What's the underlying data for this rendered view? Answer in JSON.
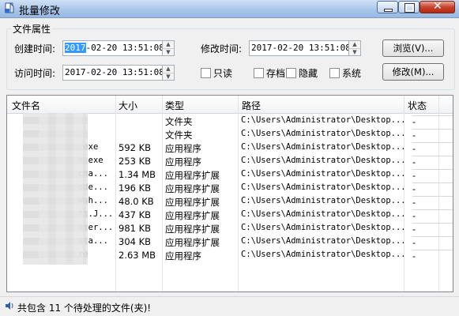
{
  "window": {
    "title": "批量修改"
  },
  "props": {
    "group_label": "文件属性",
    "created_label": "创建时间:",
    "created_sel": "2017",
    "created_rest": "-02-20 13:51:08",
    "modified_label": "修改时间:",
    "modified_value": "2017-02-20 13:51:08",
    "accessed_label": "访问时间:",
    "accessed_value": "2017-02-20 13:51:08",
    "browse_label": "浏览(V)...",
    "modify_label": "修改(M)...",
    "checks": [
      "只读",
      "存档",
      "隐藏",
      "系统"
    ]
  },
  "list": {
    "columns": [
      "文件名",
      "大小",
      "类型",
      "路径",
      "状态"
    ],
    "rows": [
      {
        "name": "",
        "size": "",
        "type": "文件夹",
        "path": "C:\\Users\\Administrator\\Desktop...",
        "status": "-"
      },
      {
        "name": "",
        "size": "",
        "type": "文件夹",
        "path": "C:\\Users\\Administrator\\Desktop...",
        "status": "-"
      },
      {
        "name": ".exe",
        "size": "592 KB",
        "type": "应用程序",
        "path": "C:\\Users\\Administrator\\Desktop...",
        "status": "-"
      },
      {
        "name": "e.exe",
        "size": "253 KB",
        "type": "应用程序",
        "path": "C:\\Users\\Administrator\\Desktop...",
        "status": "-"
      },
      {
        "name": "cha...",
        "size": "1.34 MB",
        "type": "应用程序扩展",
        "path": "C:\\Users\\Administrator\\Desktop...",
        "status": "-"
      },
      {
        "name": "ode...",
        "size": "196 KB",
        "type": "应用程序扩展",
        "path": "C:\\Users\\Administrator\\Desktop...",
        "status": "-"
      },
      {
        "name": "Wsh...",
        "size": "48.0 KB",
        "type": "应用程序扩展",
        "path": "C:\\Users\\Administrator\\Desktop...",
        "status": "-"
      },
      {
        "name": "ft.J...",
        "size": "437 KB",
        "type": "应用程序扩展",
        "path": "C:\\Users\\Administrator\\Desktop...",
        "status": "-"
      },
      {
        "name": "nter...",
        "size": "981 KB",
        "type": "应用程序扩展",
        "path": "C:\\Users\\Administrator\\Desktop...",
        "status": "-"
      },
      {
        "name": "ata...",
        "size": "304 KB",
        "type": "应用程序扩展",
        "path": "C:\\Users\\Administrator\\Desktop...",
        "status": "-"
      },
      {
        "name": "re",
        "size": "2.63 MB",
        "type": "应用程序",
        "path": "C:\\Users\\Administrator\\Desktop...",
        "status": "-"
      }
    ]
  },
  "status": {
    "text": "共包含 11 个待处理的文件(夹)!"
  }
}
